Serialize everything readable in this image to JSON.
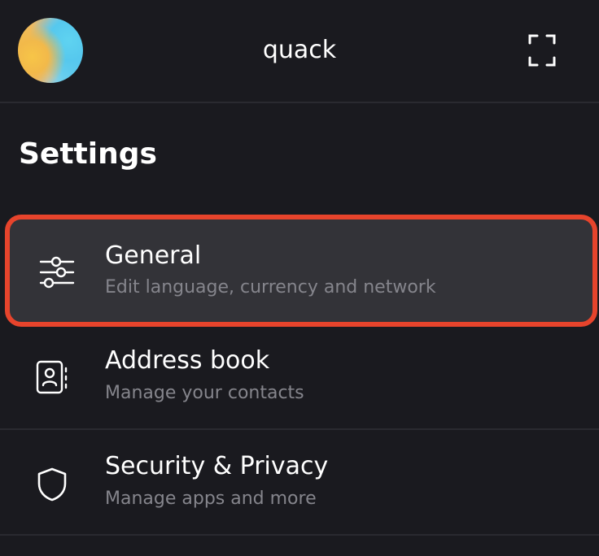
{
  "header": {
    "wallet_name": "quack",
    "avatar": "gradient-avatar",
    "expand_icon": "expand-icon"
  },
  "page": {
    "title": "Settings"
  },
  "menu": {
    "items": [
      {
        "id": "general",
        "icon": "sliders-icon",
        "title": "General",
        "subtitle": "Edit language, currency and network",
        "highlighted": true
      },
      {
        "id": "address-book",
        "icon": "contacts-icon",
        "title": "Address book",
        "subtitle": "Manage your contacts",
        "highlighted": false
      },
      {
        "id": "security-privacy",
        "icon": "shield-icon",
        "title": "Security & Privacy",
        "subtitle": "Manage apps and more",
        "highlighted": false
      }
    ]
  },
  "colors": {
    "background": "#1a1a1f",
    "highlight_border": "#e7442c",
    "highlight_fill": "#333338",
    "subtitle_text": "#85858c"
  }
}
